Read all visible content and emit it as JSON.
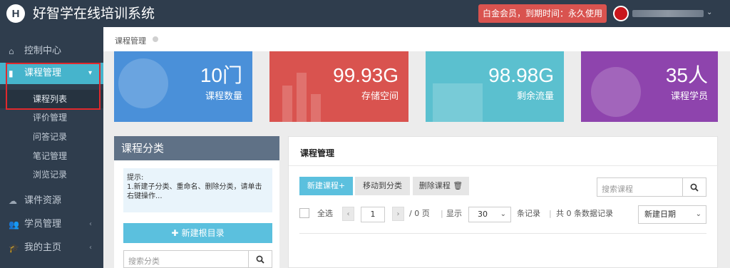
{
  "header": {
    "logo_letter": "H",
    "app_title": "好智学在线培训系统",
    "vip_badge": "白金会员，到期时间：永久使用",
    "user_caret": "⌄"
  },
  "sidebar": {
    "items": [
      {
        "label": "控制中心",
        "icon": "home-icon"
      },
      {
        "label": "课程管理",
        "icon": "book-icon"
      },
      {
        "label": "课件资源",
        "icon": "cloud-icon"
      },
      {
        "label": "学员管理",
        "icon": "users-icon"
      },
      {
        "label": "我的主页",
        "icon": "graduation-cap-icon"
      }
    ],
    "course_sub_items": [
      "课程列表",
      "评价管理",
      "问答记录",
      "笔记管理",
      "浏览记录"
    ]
  },
  "breadcrumb": {
    "label": "课程管理"
  },
  "stats": [
    {
      "value": "10门",
      "label": "课程数量",
      "color": "#4a90d9"
    },
    {
      "value": "99.93G",
      "label": "存储空间",
      "color": "#d9534f"
    },
    {
      "value": "98.98G",
      "label": "剩余流量",
      "color": "#5bc0cf"
    },
    {
      "value": "35人",
      "label": "课程学员",
      "color": "#8e44ad"
    }
  ],
  "category_panel": {
    "title": "课程分类",
    "tip_title": "提示:",
    "tip_body": "1.新建子分类、重命名、删除分类，请单击右键操作...",
    "new_root_button": "新建根目录",
    "search_placeholder": "搜索分类"
  },
  "course_panel": {
    "title": "课程管理",
    "new_course_button": "新建课程+",
    "move_button": "移动到分类",
    "delete_button": "删除课程",
    "search_placeholder": "搜索课程",
    "select_all": "全选",
    "page_current": "1",
    "page_total": "/ 0 页",
    "show_label": "显示",
    "page_size": "30",
    "records_unit": "条记录",
    "records_total": "共 0 条数据记录",
    "sort_selected": "新建日期"
  },
  "colors": {
    "topbar": "#2f3d4d",
    "accent": "#46b4cc",
    "vip_badge": "#d9534f",
    "highlight": "#e0292d"
  }
}
